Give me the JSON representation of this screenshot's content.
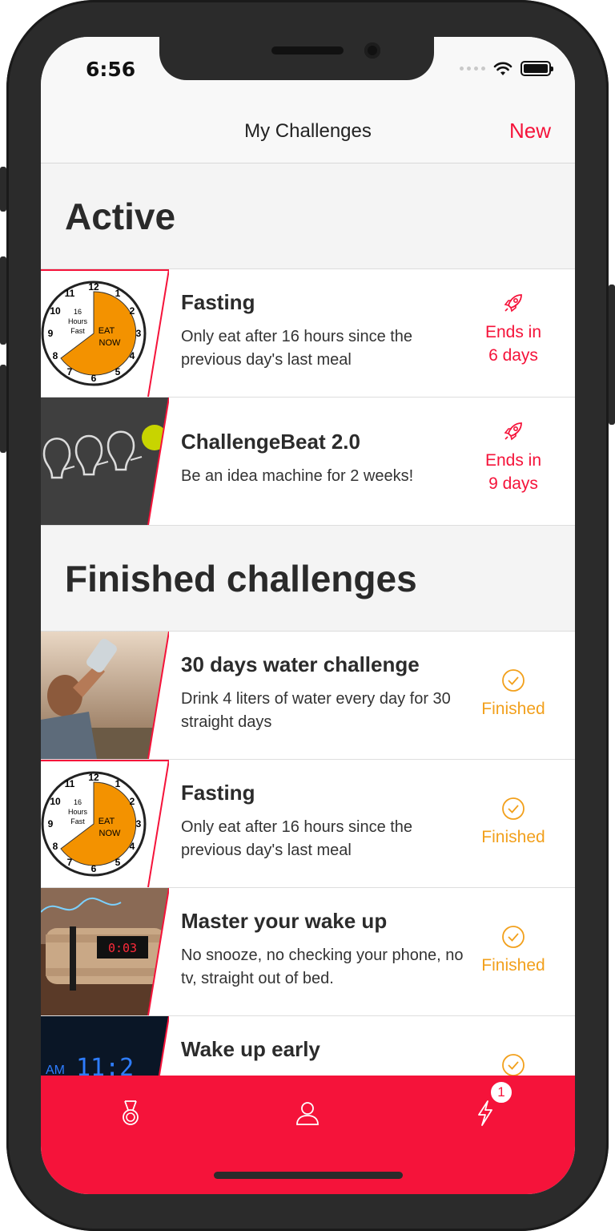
{
  "status_bar": {
    "time": "6:56"
  },
  "navbar": {
    "title": "My Challenges",
    "new_label": "New"
  },
  "sections": {
    "active": {
      "title": "Active",
      "items": [
        {
          "title": "Fasting",
          "description": "Only eat after 16 hours since the previous day's last meal",
          "status_line1": "Ends in",
          "status_line2": "6 days",
          "image": "clock-fasting"
        },
        {
          "title": "ChallengeBeat 2.0",
          "description": "Be an idea machine for 2 weeks!",
          "status_line1": "Ends in",
          "status_line2": "9 days",
          "image": "lightbulbs"
        }
      ]
    },
    "finished": {
      "title": "Finished challenges",
      "items": [
        {
          "title": "30 days water challenge",
          "description": "Drink 4 liters of water every day for 30 straight days",
          "status": "Finished",
          "image": "man-drinking-water"
        },
        {
          "title": "Fasting",
          "description": "Only eat after 16 hours since the previous day's last meal",
          "status": "Finished",
          "image": "clock-fasting"
        },
        {
          "title": "Master your wake up",
          "description": "No snooze, no checking your phone, no tv, straight out of bed.",
          "status": "Finished",
          "image": "alarm-clock-bomb"
        },
        {
          "title": "Wake up early",
          "description": "",
          "status": "",
          "image": "digital-clock"
        }
      ]
    }
  },
  "clock_image": {
    "numbers": [
      "12",
      "1",
      "2",
      "3",
      "4",
      "5",
      "6",
      "7",
      "8",
      "9",
      "10",
      "11"
    ],
    "label_top": "16",
    "label_mid": "Hours",
    "label_bottom": "Fast",
    "eat": "EAT",
    "now": "NOW"
  },
  "alarm_display": "0:03",
  "digital_clock": {
    "am": "AM",
    "digits": "11:2"
  },
  "tabbar": {
    "tabs": [
      {
        "icon": "medal-icon"
      },
      {
        "icon": "person-icon"
      },
      {
        "icon": "lightning-icon",
        "badge": "1"
      }
    ]
  },
  "colors": {
    "accent": "#f5133a",
    "finished": "#f2a01c",
    "clock_fill": "#f39200"
  }
}
